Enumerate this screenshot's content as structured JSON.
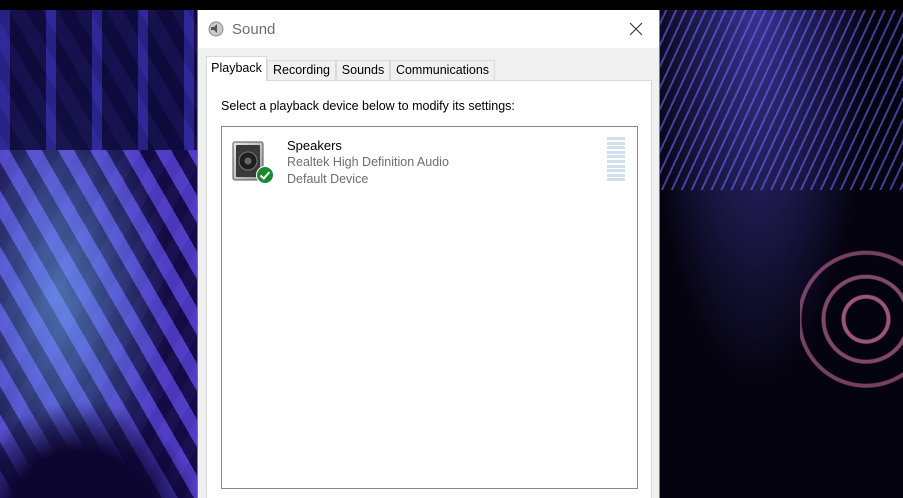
{
  "window": {
    "title": "Sound"
  },
  "tabs": [
    {
      "label": "Playback",
      "active": true
    },
    {
      "label": "Recording",
      "active": false
    },
    {
      "label": "Sounds",
      "active": false
    },
    {
      "label": "Communications",
      "active": false
    }
  ],
  "playback": {
    "instruction": "Select a playback device below to modify its settings:",
    "devices": [
      {
        "name": "Speakers",
        "driver": "Realtek High Definition Audio",
        "status": "Default Device",
        "icon": "speaker-icon",
        "badge": "default-check-icon",
        "level": 0
      }
    ]
  },
  "colors": {
    "badge_green": "#1a8a2e",
    "meter_idle": "#cfe0ef",
    "title_text": "#6d6d6d"
  }
}
